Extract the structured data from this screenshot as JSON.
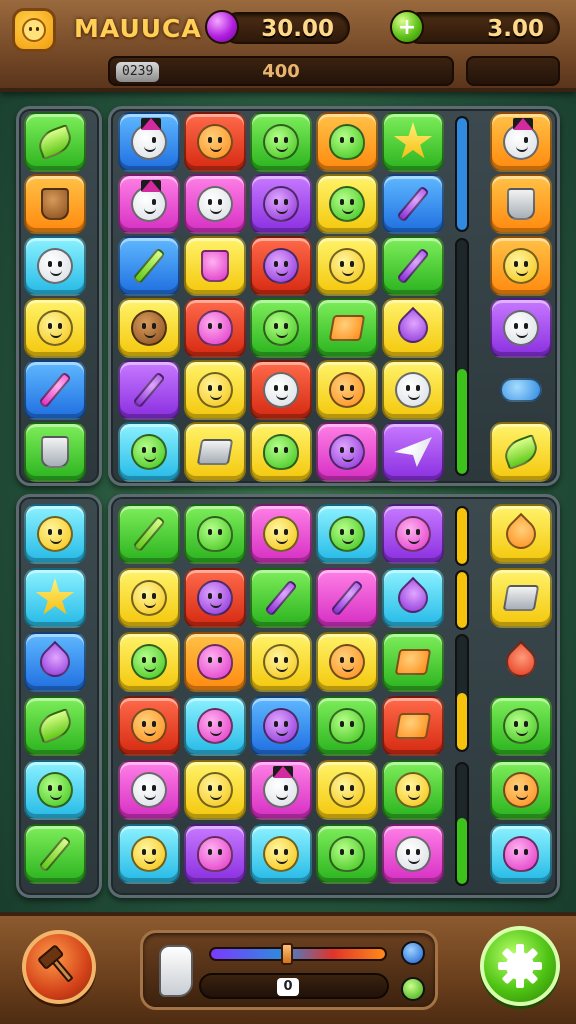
{
  "header": {
    "title": "MAUUCA",
    "coins_value": "30.00",
    "gems_value": "3.00",
    "level_label": "0239",
    "progress_value": "400"
  },
  "colors": {
    "wood": "#6e4424",
    "board": "#2c383c",
    "accent_green": "#4fc414"
  },
  "top_board": {
    "left_column": [
      {
        "tile": "green",
        "icon": "leaf-icon"
      },
      {
        "tile": "orange",
        "icon": "barrel-icon"
      },
      {
        "tile": "cyan",
        "icon": "ghost-face-icon"
      },
      {
        "tile": "yellow",
        "icon": "smile-face-icon"
      },
      {
        "tile": "blue",
        "icon": "pen-icon"
      },
      {
        "tile": "green",
        "icon": "cup-icon"
      }
    ],
    "grid": [
      [
        {
          "tile": "blue",
          "icon": "wizard-face-icon"
        },
        {
          "tile": "red",
          "icon": "orange-face-icon"
        },
        {
          "tile": "green",
          "icon": "green-monster-icon"
        },
        {
          "tile": "orange",
          "icon": "apple-icon"
        },
        {
          "tile": "green",
          "icon": "star-icon"
        }
      ],
      [
        {
          "tile": "pink",
          "icon": "wizard-face-icon"
        },
        {
          "tile": "pink",
          "icon": "onion-face-icon"
        },
        {
          "tile": "purple",
          "icon": "purple-face-icon"
        },
        {
          "tile": "yellow",
          "icon": "green-face-icon"
        },
        {
          "tile": "blue",
          "icon": "brush-icon"
        }
      ],
      [
        {
          "tile": "blue",
          "icon": "stick-icon"
        },
        {
          "tile": "yellow",
          "icon": "bowl-icon"
        },
        {
          "tile": "red",
          "icon": "bat-icon"
        },
        {
          "tile": "yellow",
          "icon": "smile-face-icon"
        },
        {
          "tile": "green",
          "icon": "brush-icon"
        }
      ],
      [
        {
          "tile": "yellow",
          "icon": "brown-face-icon"
        },
        {
          "tile": "red",
          "icon": "plum-icon"
        },
        {
          "tile": "green",
          "icon": "green-face-icon"
        },
        {
          "tile": "green",
          "icon": "stack-icon"
        },
        {
          "tile": "yellow",
          "icon": "drop-icon"
        }
      ],
      [
        {
          "tile": "purple",
          "icon": "brush-icon"
        },
        {
          "tile": "yellow",
          "icon": "chick-face-icon"
        },
        {
          "tile": "red",
          "icon": "ghost-face-icon"
        },
        {
          "tile": "yellow",
          "icon": "orange-face-icon"
        },
        {
          "tile": "yellow",
          "icon": "cat-face-icon"
        }
      ],
      [
        {
          "tile": "cyan",
          "icon": "yoda-face-icon"
        },
        {
          "tile": "yellow",
          "icon": "spool-icon"
        },
        {
          "tile": "yellow",
          "icon": "apple-icon"
        },
        {
          "tile": "pink",
          "icon": "purple-face-icon"
        },
        {
          "tile": "purple",
          "icon": "plane-icon"
        }
      ]
    ],
    "right_column": [
      {
        "tile": "orange",
        "icon": "wizard-face-icon"
      },
      {
        "tile": "orange",
        "icon": "cup-icon"
      },
      {
        "tile": "orange",
        "icon": "smile-face-icon"
      },
      {
        "tile": "purple",
        "icon": "cat-face-icon"
      },
      {
        "tile": "none",
        "icon": "cloud-icon"
      },
      {
        "tile": "yellow",
        "icon": "leaf-icon"
      }
    ],
    "gauges": [
      {
        "level": 1.0,
        "color": "#2f8ae0"
      },
      {
        "level": 0.45,
        "color": "#3cc21a"
      }
    ]
  },
  "bottom_board": {
    "left_column": [
      {
        "tile": "cyan",
        "icon": "smile-face-icon"
      },
      {
        "tile": "cyan",
        "icon": "star-icon"
      },
      {
        "tile": "blue",
        "icon": "drop-icon"
      },
      {
        "tile": "green",
        "icon": "leaf-icon"
      },
      {
        "tile": "cyan",
        "icon": "green-face-icon"
      },
      {
        "tile": "green",
        "icon": "stick-icon"
      }
    ],
    "grid": [
      [
        {
          "tile": "green",
          "icon": "stick-icon"
        },
        {
          "tile": "green",
          "icon": "apple-icon"
        },
        {
          "tile": "pink",
          "icon": "chick-face-icon"
        },
        {
          "tile": "cyan",
          "icon": "green-monster-icon"
        },
        {
          "tile": "purple",
          "icon": "devil-face-icon"
        }
      ],
      [
        {
          "tile": "yellow",
          "icon": "chick-face-icon"
        },
        {
          "tile": "red",
          "icon": "purple-face-icon"
        },
        {
          "tile": "green",
          "icon": "brush-icon"
        },
        {
          "tile": "pink",
          "icon": "brush-icon"
        },
        {
          "tile": "cyan",
          "icon": "drop-icon"
        }
      ],
      [
        {
          "tile": "yellow",
          "icon": "green-face-icon"
        },
        {
          "tile": "orange",
          "icon": "plum-icon"
        },
        {
          "tile": "yellow",
          "icon": "chick-face-icon"
        },
        {
          "tile": "yellow",
          "icon": "orange-face-icon"
        },
        {
          "tile": "green",
          "icon": "stack-icon"
        }
      ],
      [
        {
          "tile": "red",
          "icon": "orange-face-icon"
        },
        {
          "tile": "cyan",
          "icon": "pink-face-icon"
        },
        {
          "tile": "blue",
          "icon": "purple-face-icon"
        },
        {
          "tile": "green",
          "icon": "apple-icon"
        },
        {
          "tile": "red",
          "icon": "stack-icon"
        }
      ],
      [
        {
          "tile": "pink",
          "icon": "onion-face-icon"
        },
        {
          "tile": "yellow",
          "icon": "smile-face-icon"
        },
        {
          "tile": "pink",
          "icon": "wizard-face-icon"
        },
        {
          "tile": "yellow",
          "icon": "smile-face-icon"
        },
        {
          "tile": "green",
          "icon": "chick-face-icon"
        }
      ],
      [
        {
          "tile": "cyan",
          "icon": "chick-face-icon"
        },
        {
          "tile": "purple",
          "icon": "plum-icon"
        },
        {
          "tile": "cyan",
          "icon": "smile-face-icon"
        },
        {
          "tile": "green",
          "icon": "apple-icon"
        },
        {
          "tile": "pink",
          "icon": "bandit-face-icon"
        }
      ]
    ],
    "right_column": [
      {
        "tile": "yellow",
        "icon": "carrot-icon"
      },
      {
        "tile": "yellow",
        "icon": "block-icon"
      },
      {
        "tile": "none",
        "icon": "splash-icon"
      },
      {
        "tile": "green",
        "icon": "green-monster-icon"
      },
      {
        "tile": "green",
        "icon": "orange-face-icon"
      },
      {
        "tile": "cyan",
        "icon": "plum-icon"
      }
    ],
    "gauges": [
      {
        "level": 1.0,
        "color": "#f5c20c"
      },
      {
        "level": 1.0,
        "color": "#f5c20c"
      },
      {
        "level": 0.5,
        "color": "#f5c20c"
      },
      {
        "level": 0.55,
        "color": "#3cc21a"
      }
    ]
  },
  "footer": {
    "tool_left": "hammer-icon",
    "slider_level": 0.42,
    "counter_value": "0",
    "tool_right": "gear-icon"
  }
}
